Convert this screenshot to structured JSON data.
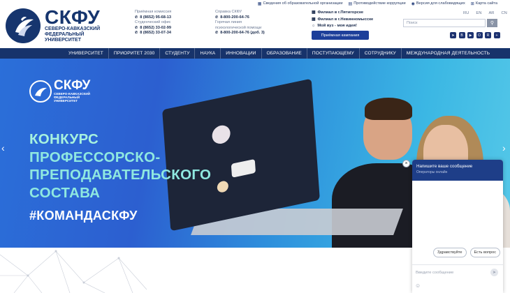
{
  "utility": [
    {
      "icon": "building-icon",
      "label": "Сведения об образовательной организации"
    },
    {
      "icon": "document-icon",
      "label": "Противодействие коррупции"
    },
    {
      "icon": "eye-icon",
      "label": "Версия для слабовидящих"
    },
    {
      "icon": "sitemap-icon",
      "label": "Карта сайта"
    }
  ],
  "logo": {
    "abbr": "СКФУ",
    "line1": "Северо-Кавказский",
    "line2": "федеральный",
    "line3": "университет"
  },
  "contacts1": {
    "label1": "Приёмная комиссия",
    "phone1": "8 (8652) 95-68-13",
    "label2": "Студенческий офис",
    "phone2": "8 (8652) 33-02-99",
    "phone3": "8 (8652) 33-07-34"
  },
  "contacts2": {
    "label1": "Справка СКФУ",
    "phone1": "8-800-200-64-76",
    "label2a": "Горячая линия",
    "label2b": "психологической помощи",
    "phone2": "8-800-200-64-76 (доб. 3)"
  },
  "branches": [
    "Филиал в г.Пятигорске",
    "Филиал в г.Невинномысске",
    "Мой вуз - моя идея!"
  ],
  "campaign_button": "Приёмная кампания",
  "langs": [
    "RU",
    "EN",
    "AR",
    "CN"
  ],
  "search": {
    "placeholder": "Поиск"
  },
  "social": [
    {
      "icon": "telegram-icon",
      "glyph": "➤"
    },
    {
      "icon": "vk-icon",
      "glyph": "В"
    },
    {
      "icon": "youtube-icon",
      "glyph": "▶"
    },
    {
      "icon": "ok-icon",
      "glyph": "О"
    },
    {
      "icon": "rutube-icon",
      "glyph": "R"
    },
    {
      "icon": "plus-icon",
      "glyph": "+"
    }
  ],
  "nav": [
    "УНИВЕРСИТЕТ",
    "ПРИОРИТЕТ 2030",
    "СТУДЕНТУ",
    "НАУКА",
    "ИННОВАЦИИ",
    "ОБРАЗОВАНИЕ",
    "ПОСТУПАЮЩЕМУ",
    "СОТРУДНИКУ",
    "МЕЖДУНАРОДНАЯ ДЕЯТЕЛЬНОСТЬ"
  ],
  "hero": {
    "logo_abbr": "СКФУ",
    "logo_line1": "Северо-Кавказский",
    "logo_line2": "федеральный",
    "logo_line3": "университет",
    "title1": "Конкурс",
    "title2": "профессорско-",
    "title3": "преподавательского",
    "title4": "состава",
    "tag": "#КОМАНДАСКФУ"
  },
  "chat": {
    "title": "Напишите ваше сообщение",
    "subtitle": "Операторы онлайн",
    "quick1": "Здравствуйте",
    "quick2": "Есть вопрос",
    "input_placeholder": "Введите сообщение"
  }
}
